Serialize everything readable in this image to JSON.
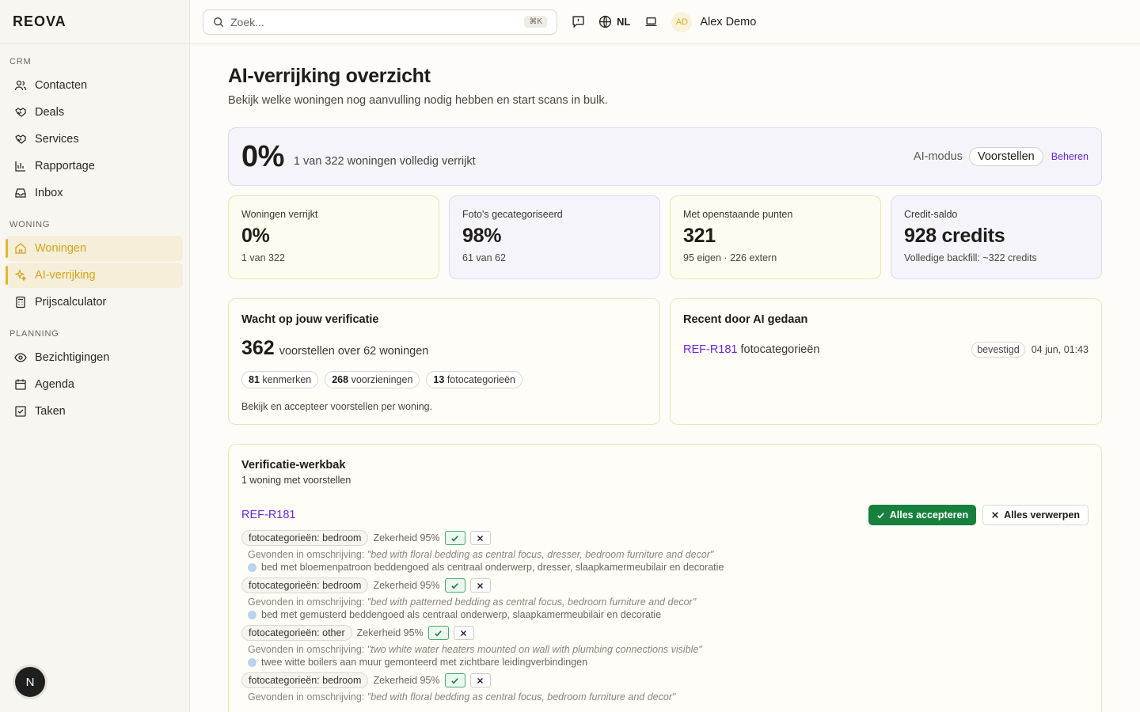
{
  "brand": "REOVA",
  "search": {
    "placeholder": "Zoek...",
    "shortcut": "⌘K"
  },
  "topbar": {
    "language": "NL",
    "user_initials": "AD",
    "user_name": "Alex Demo"
  },
  "sidebar": {
    "sections": [
      {
        "heading": "CRM",
        "items": [
          {
            "label": "Contacten",
            "icon": "users-icon"
          },
          {
            "label": "Deals",
            "icon": "handshake-icon"
          },
          {
            "label": "Services",
            "icon": "handshake-icon"
          },
          {
            "label": "Rapportage",
            "icon": "bar-chart-icon"
          },
          {
            "label": "Inbox",
            "icon": "inbox-icon"
          }
        ]
      },
      {
        "heading": "WONING",
        "items": [
          {
            "label": "Woningen",
            "icon": "home-icon",
            "active": true
          },
          {
            "label": "AI-verrijking",
            "icon": "sparkles-icon",
            "active": true
          },
          {
            "label": "Prijscalculator",
            "icon": "calculator-icon"
          }
        ]
      },
      {
        "heading": "PLANNING",
        "items": [
          {
            "label": "Bezichtigingen",
            "icon": "eye-icon"
          },
          {
            "label": "Agenda",
            "icon": "calendar-icon"
          },
          {
            "label": "Taken",
            "icon": "check-square-icon"
          }
        ]
      }
    ],
    "avatar": "N"
  },
  "page": {
    "title": "AI-verrijking overzicht",
    "subtitle": "Bekijk welke woningen nog aanvulling nodig hebben en start scans in bulk."
  },
  "hero": {
    "percent": "0%",
    "description": "1 van 322 woningen volledig verrijkt",
    "ai_mode_label": "AI-modus",
    "ai_mode_value": "Voorstellen",
    "manage": "Beheren"
  },
  "stats": [
    {
      "label": "Woningen verrijkt",
      "value": "0%",
      "sub": "1 van 322",
      "tone": "yellow"
    },
    {
      "label": "Foto's gecategoriseerd",
      "value": "98%",
      "sub": "61 van 62",
      "tone": "purple"
    },
    {
      "label": "Met openstaande punten",
      "value": "321",
      "sub": "95 eigen · 226 extern",
      "tone": "yellow"
    },
    {
      "label": "Credit-saldo",
      "value": "928 credits",
      "sub": "Volledige backfill: ~322 credits",
      "tone": "purple"
    }
  ],
  "waiting": {
    "title": "Wacht op jouw verificatie",
    "count": "362",
    "description": "voorstellen over 62 woningen",
    "chips": [
      {
        "num": "81",
        "label": "kenmerken"
      },
      {
        "num": "268",
        "label": "voorzieningen"
      },
      {
        "num": "13",
        "label": "fotocategorieën"
      }
    ],
    "footer": "Bekijk en accepteer voorstellen per woning."
  },
  "recent": {
    "title": "Recent door AI gedaan",
    "ref": "REF-R181",
    "text": "fotocategorieën",
    "badge": "bevestigd",
    "timestamp": "04 jun, 01:43"
  },
  "workbench": {
    "title": "Verificatie-werkbak",
    "subtitle": "1 woning met voorstellen",
    "ref": "REF-R181",
    "accept_all": "Alles accepteren",
    "reject_all": "Alles verwerpen",
    "found_prefix": "Gevonden in omschrijving:",
    "suggestions": [
      {
        "tag": "fotocategorieën: bedroom",
        "confidence": "Zekerheid 95%",
        "found": "\"bed with floral bedding as central focus, dresser, bedroom furniture and decor\"",
        "translation": "bed met bloemenpatroon beddengoed als centraal onderwerp, dresser, slaapkamermeubilair en decoratie"
      },
      {
        "tag": "fotocategorieën: bedroom",
        "confidence": "Zekerheid 95%",
        "found": "\"bed with patterned bedding as central focus, bedroom furniture and decor\"",
        "translation": "bed met gemusterd beddengoed als centraal onderwerp, slaapkamermeubilair en decoratie"
      },
      {
        "tag": "fotocategorieën: other",
        "confidence": "Zekerheid 95%",
        "found": "\"two white water heaters mounted on wall with plumbing connections visible\"",
        "translation": "twee witte boilers aan muur gemonteerd met zichtbare leidingverbindingen"
      },
      {
        "tag": "fotocategorieën: bedroom",
        "confidence": "Zekerheid 95%",
        "found": "\"bed with floral bedding as central focus, bedroom furniture and decor\"",
        "translation": ""
      }
    ]
  },
  "colors": {
    "accent_yellow": "#e2b534",
    "link_purple": "#6d28d9",
    "accept_green": "#16803c"
  }
}
